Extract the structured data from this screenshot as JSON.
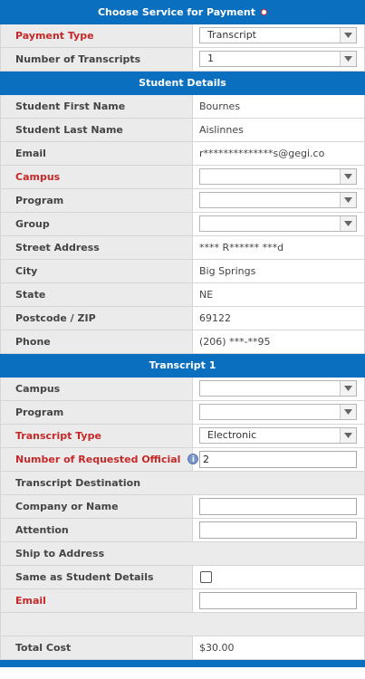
{
  "payment": {
    "header": "Choose Service for Payment",
    "payment_type_label": "Payment Type",
    "payment_type_value": "Transcript",
    "num_transcripts_label": "Number of Transcripts",
    "num_transcripts_value": "1"
  },
  "student": {
    "header": "Student Details",
    "first_name_label": "Student First Name",
    "first_name": "Bournes",
    "last_name_label": "Student Last Name",
    "last_name": "Aislinnes",
    "email_label": "Email",
    "email": "r**************s@gegi.co",
    "campus_label": "Campus",
    "campus_value": "",
    "program_label": "Program",
    "program_value": "",
    "group_label": "Group",
    "group_value": "",
    "street_label": "Street Address",
    "street": "**** R****** ***d",
    "city_label": "City",
    "city": "Big Springs",
    "state_label": "State",
    "state": "NE",
    "postcode_label": "Postcode / ZIP",
    "postcode": "69122",
    "phone_label": "Phone",
    "phone": "(206) ***-**95"
  },
  "transcript": {
    "header": "Transcript 1",
    "campus_label": "Campus",
    "campus_value": "",
    "program_label": "Program",
    "program_value": "",
    "type_label": "Transcript Type",
    "type_value": "Electronic",
    "num_official_label": "Number of Requested Official",
    "num_official_value": "2",
    "info_icon": "i",
    "destination_label": "Transcript Destination",
    "company_label": "Company or Name",
    "company_value": "",
    "attention_label": "Attention",
    "attention_value": "",
    "ship_label": "Ship to Address",
    "same_label": "Same as Student Details",
    "same_checked": false,
    "email_label": "Email",
    "email_value": ""
  },
  "total": {
    "label": "Total Cost",
    "value": "$30.00"
  },
  "colors": {
    "header_blue": "#0b6fc0",
    "required_red": "#c62828",
    "label_bg": "#ebebeb"
  }
}
